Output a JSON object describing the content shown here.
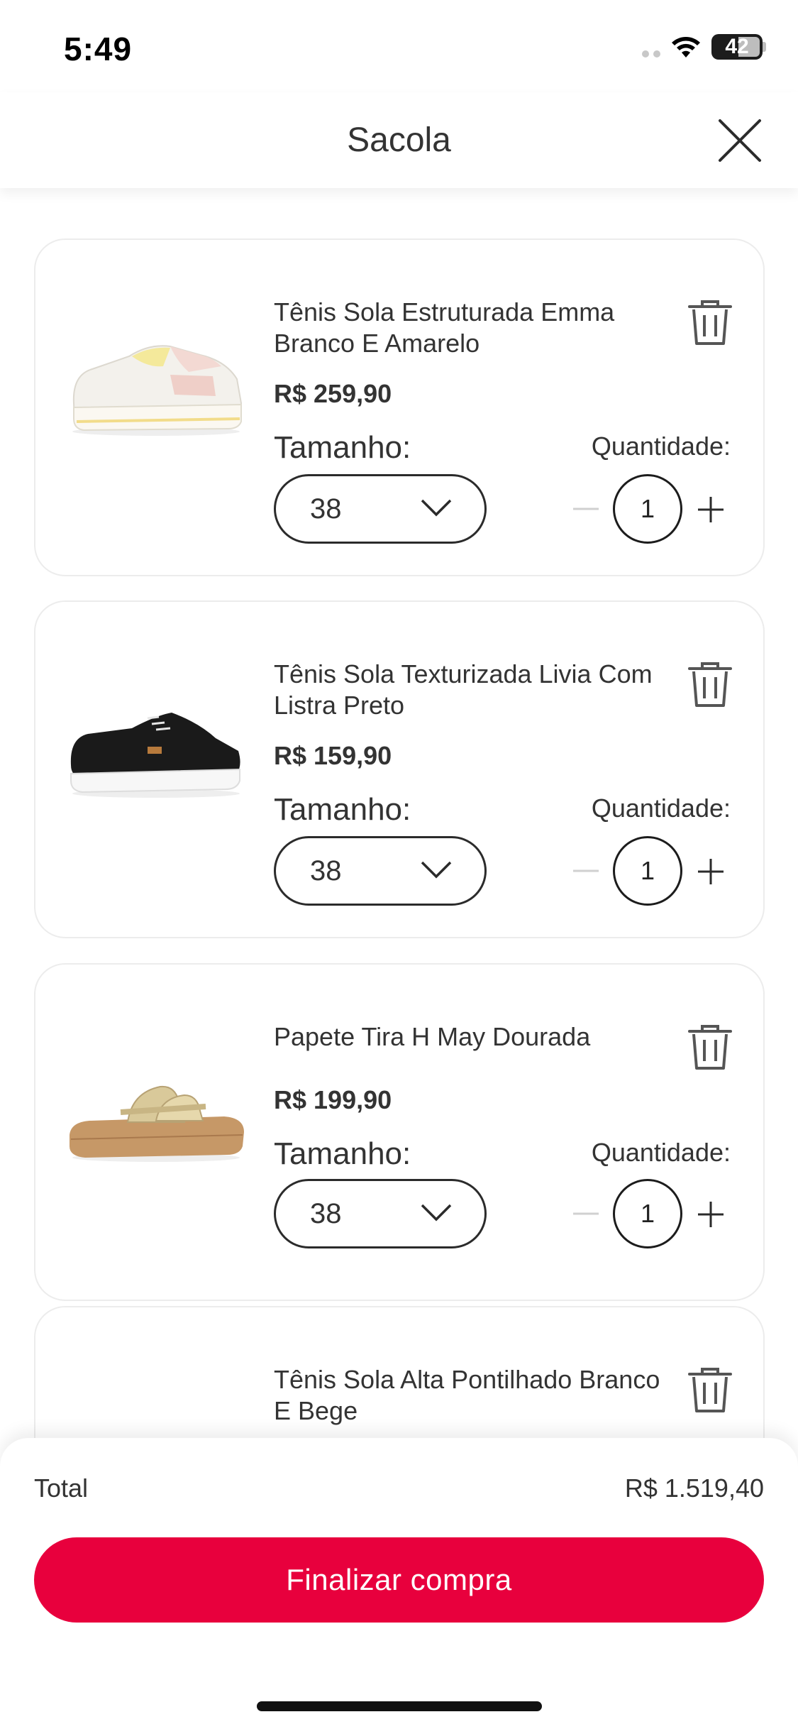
{
  "status_bar": {
    "time": "5:49",
    "battery_level": "42"
  },
  "header": {
    "title": "Sacola"
  },
  "cart": {
    "size_label": "Tamanho:",
    "quantity_label": "Quantidade:",
    "items": [
      {
        "name": "Tênis Sola Estruturada Emma Branco E Amarelo",
        "price": "R$ 259,90",
        "size": "38",
        "quantity": "1"
      },
      {
        "name": "Tênis Sola Texturizada Livia Com Listra Preto",
        "price": "R$ 159,90",
        "size": "38",
        "quantity": "1"
      },
      {
        "name": "Papete Tira H May Dourada",
        "price": "R$ 199,90",
        "size": "38",
        "quantity": "1"
      },
      {
        "name": "Tênis Sola Alta Pontilhado Branco E Bege"
      }
    ]
  },
  "summary": {
    "total_label": "Total",
    "total_value": "R$ 1.519,40",
    "checkout_label": "Finalizar compra"
  },
  "colors": {
    "accent": "#e8003d"
  }
}
